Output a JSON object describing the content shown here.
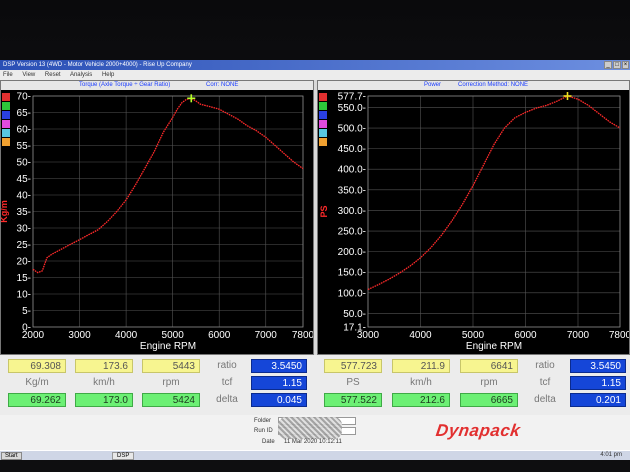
{
  "window": {
    "title": "DSP Version 13 (4WD - Motor Vehicle 2000+4000) - Rise Up Company",
    "menu": [
      "File",
      "View",
      "Reset",
      "Analysis",
      "Help"
    ]
  },
  "panels": [
    {
      "header_title": "Torque (Axle Torque ÷ Gear Ratio)",
      "header_corr": "Corr: NONE",
      "swatch_colors": [
        "#e23030",
        "#2ec73a",
        "#2a3fe0",
        "#e04be0",
        "#58c7e0",
        "#f0a030"
      ]
    },
    {
      "header_title": "Power",
      "header_corr": "Correction Method: NONE",
      "swatch_colors": [
        "#e23030",
        "#2ec73a",
        "#2a3fe0",
        "#e04be0",
        "#58c7e0",
        "#f0a030"
      ]
    }
  ],
  "chart_data": [
    {
      "type": "line",
      "title": "Torque (Axle Torque ÷ Gear Ratio)",
      "xlabel": "Engine RPM",
      "ylabel": "Kg/m",
      "xlim": [
        2000,
        7800
      ],
      "ylim": [
        0,
        70
      ],
      "x_ticks": [
        "2000",
        "3000",
        "4000",
        "5000",
        "6000",
        "7000",
        "7800"
      ],
      "y_ticks": [
        "0-",
        "5-",
        "10-",
        "15-",
        "20-",
        "25-",
        "30-",
        "35-",
        "40-",
        "45-",
        "50-",
        "55-",
        "60-",
        "65-",
        "70-"
      ],
      "grid": true,
      "series_color": "#ff2a2a",
      "marker_color": "#b6ff2a",
      "marker": {
        "x": 5400,
        "y": 69.3
      },
      "series": [
        {
          "x": [
            2000,
            2100,
            2200,
            2250,
            2300,
            2400,
            2600,
            2800,
            3000,
            3200,
            3400,
            3600,
            3800,
            4000,
            4200,
            4400,
            4600,
            4800,
            5000,
            5100,
            5200,
            5300,
            5400,
            5500,
            5600,
            5800,
            6000,
            6200,
            6400,
            6600,
            6800,
            7000,
            7200,
            7400,
            7600,
            7800
          ],
          "y": [
            17.5,
            16.5,
            17.0,
            19.0,
            21.0,
            22.0,
            23.5,
            25.0,
            26.5,
            28.0,
            29.5,
            32.0,
            35.0,
            38.5,
            43.0,
            48.0,
            53.0,
            59.0,
            63.5,
            66.0,
            68.0,
            69.0,
            69.3,
            68.5,
            67.5,
            66.8,
            66.0,
            64.5,
            63.0,
            61.0,
            59.5,
            57.5,
            55.0,
            52.5,
            50.0,
            48.0
          ]
        }
      ]
    },
    {
      "type": "line",
      "title": "Power",
      "xlabel": "Engine RPM",
      "ylabel": "PS",
      "xlim": [
        3000,
        7800
      ],
      "ylim": [
        17.1,
        577.7
      ],
      "x_ticks": [
        "3000",
        "4000",
        "5000",
        "6000",
        "7000",
        "7800"
      ],
      "y_ticks": [
        "17.1-",
        "50.0-",
        "100.0-",
        "150.0-",
        "200.0-",
        "250.0-",
        "300.0-",
        "350.0-",
        "400.0-",
        "450.0-",
        "500.0-",
        "550.0-",
        "577.7-"
      ],
      "grid": true,
      "series_color": "#ff2a2a",
      "marker_color": "#f0e020",
      "marker": {
        "x": 6800,
        "y": 577.7
      },
      "series": [
        {
          "x": [
            3000,
            3200,
            3400,
            3600,
            3800,
            4000,
            4200,
            4400,
            4600,
            4800,
            5000,
            5200,
            5400,
            5600,
            5800,
            6000,
            6200,
            6400,
            6600,
            6800,
            7000,
            7200,
            7400,
            7600,
            7800
          ],
          "y": [
            108,
            120,
            133,
            148,
            165,
            185,
            210,
            240,
            275,
            315,
            360,
            410,
            460,
            500,
            525,
            538,
            548,
            555,
            565,
            577.7,
            570,
            555,
            535,
            515,
            500
          ]
        }
      ]
    }
  ],
  "readout_left": {
    "torque_max": "69.308",
    "speed_max": "173.6",
    "rpm_max": "5443",
    "torque_unit": "Kg/m",
    "speed_unit": "km/h",
    "rpm_unit": "rpm",
    "torque_cur": "69.262",
    "speed_cur": "173.0",
    "rpm_cur": "5424",
    "ratio_label": "ratio",
    "ratio_value": "3.5450",
    "tcf_label": "tcf",
    "tcf_value": "1.15",
    "delta_label": "delta",
    "delta_value": "0.045"
  },
  "readout_right": {
    "power_max": "577.723",
    "speed_max": "211.9",
    "rpm_max": "6641",
    "power_unit": "PS",
    "speed_unit": "km/h",
    "rpm_unit": "rpm",
    "power_cur": "577.522",
    "speed_cur": "212.6",
    "rpm_cur": "6665",
    "ratio_label": "ratio",
    "ratio_value": "3.5450",
    "tcf_label": "tcf",
    "tcf_value": "1.15",
    "delta_label": "delta",
    "delta_value": "0.201"
  },
  "footer": {
    "folder_label": "Folder",
    "run_label": "Run ID",
    "date_label": "Date",
    "date_value": "11 Mar 2020 10:12:11",
    "logo_text": "Dynapack"
  },
  "taskbar": {
    "start_label": "Start",
    "task_label": "DSP",
    "clock": "4:01 pm"
  }
}
